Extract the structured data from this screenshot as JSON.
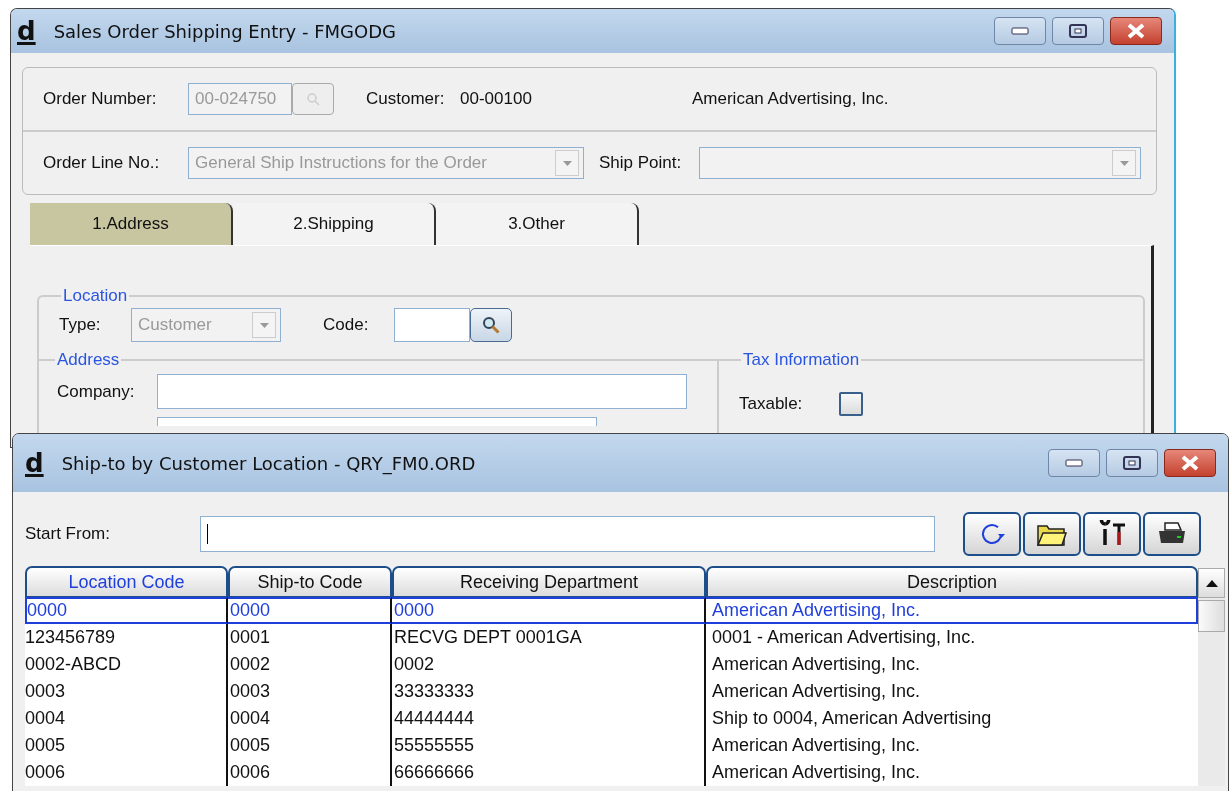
{
  "main_window": {
    "logo": "d",
    "title": "Sales Order Shipping Entry - FMGODG",
    "order_number": {
      "label": "Order Number:",
      "value": "00-024750",
      "disabled": true
    },
    "customer": {
      "label": "Customer:",
      "code": "00-00100",
      "name": "American Advertising, Inc."
    },
    "order_line": {
      "label": "Order Line No.:",
      "value": "General Ship Instructions for the Order",
      "disabled": true
    },
    "ship_point": {
      "label": "Ship Point:",
      "disabled": true
    },
    "tabs": [
      {
        "label": "1.Address",
        "selected": true
      },
      {
        "label": "2.Shipping",
        "selected": false
      },
      {
        "label": "3.Other",
        "selected": false
      }
    ],
    "location": {
      "legend": "Location",
      "type_label": "Type:",
      "type_value": "Customer",
      "type_disabled": true,
      "code_label": "Code:"
    },
    "address": {
      "legend": "Address",
      "company_label": "Company:"
    },
    "tax": {
      "legend": "Tax Information",
      "taxable_label": "Taxable:",
      "taxable_checked": false
    }
  },
  "lookup_window": {
    "logo": "d",
    "title": "Ship-to by Customer Location - QRY_FM0.ORD",
    "start_from_label": "Start From:",
    "columns": [
      {
        "label": "Location Code",
        "selected": true
      },
      {
        "label": "Ship-to Code",
        "selected": false
      },
      {
        "label": "Receiving Department",
        "selected": false
      },
      {
        "label": "Description",
        "selected": false
      }
    ],
    "rows": [
      {
        "cells": [
          "0000",
          "0000",
          "0000",
          "American Advertising, Inc."
        ],
        "selected": true
      },
      {
        "cells": [
          "123456789",
          "0001",
          "RECVG DEPT 0001GA",
          "0001 - American Advertising, Inc."
        ],
        "selected": false
      },
      {
        "cells": [
          "0002-ABCD",
          "0002",
          "0002",
          "American Advertising, Inc."
        ],
        "selected": false
      },
      {
        "cells": [
          "0003",
          "0003",
          "33333333",
          "American Advertising, Inc."
        ],
        "selected": false
      },
      {
        "cells": [
          "0004",
          "0004",
          "44444444",
          "Ship to 0004, American Advertising"
        ],
        "selected": false
      },
      {
        "cells": [
          "0005",
          "0005",
          "55555555",
          "American Advertising, Inc."
        ],
        "selected": false
      },
      {
        "cells": [
          "0006",
          "0006",
          "66666666",
          "American Advertising, Inc."
        ],
        "selected": false
      }
    ]
  }
}
